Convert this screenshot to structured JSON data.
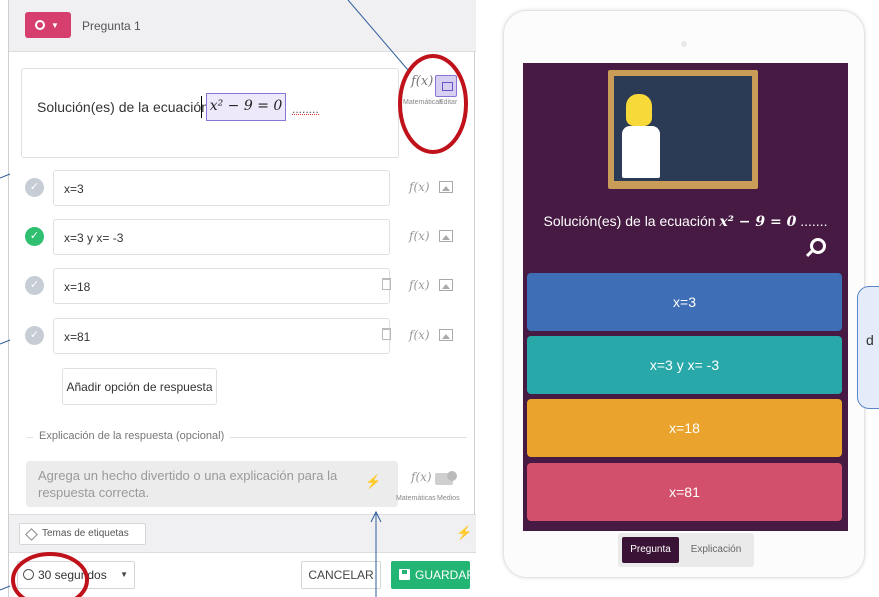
{
  "editor": {
    "question_label": "Pregunta 1",
    "question_text": "Solución(es) de la ecuación",
    "formula": "x² − 9 = 0",
    "trailing_dots": "........",
    "math_tool": "f(x)",
    "math_caption": "Matemáticas",
    "edit_caption": "Editar",
    "answers": [
      {
        "text": "x=3",
        "correct": false
      },
      {
        "text": "x=3 y x= -3",
        "correct": true
      },
      {
        "text": "x=18",
        "correct": false
      },
      {
        "text": "x=81",
        "correct": false
      }
    ],
    "add_option_label": "Añadir opción de respuesta",
    "explanation_label": "Explicación de la respuesta (opcional)",
    "explanation_placeholder": "Agrega un hecho divertido o una explicación para la respuesta correcta.",
    "media_caption": "Medios",
    "tags_label": "Temas de etiquetas",
    "timer_label": "30 segundos",
    "cancel_label": "CANCELAR",
    "save_label": "GUARDAR"
  },
  "preview": {
    "question_text": "Solución(es) de la ecuación",
    "formula": "x² − 9 = 0",
    "trailing_dots": ".......",
    "options": [
      {
        "text": "x=3",
        "color": "#3e6fb6"
      },
      {
        "text": "x=3 y x= -3",
        "color": "#29a8aa"
      },
      {
        "text": "x=18",
        "color": "#eaa42e"
      },
      {
        "text": "x=81",
        "color": "#d2506b"
      }
    ],
    "toggle_question": "Pregunta",
    "toggle_explanation": "Explicación"
  },
  "side_tab": {
    "letter": "d"
  },
  "colors": {
    "accent": "#d63e6e",
    "correct": "#2fbf71",
    "save": "#22b573",
    "screen": "#461a42",
    "annotation": "#c0121b"
  }
}
